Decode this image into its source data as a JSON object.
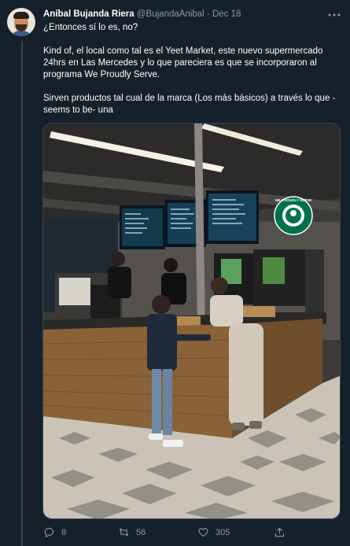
{
  "tweet": {
    "author_name": "Aníbal Bujanda Riera",
    "handle": "@BujandaAnibal",
    "separator": "·",
    "date": "Dec 18",
    "paragraphs": [
      "¿Entonces sí lo es, no?",
      "Kind of, el local como tal es el Yeet Market, este nuevo supermercado 24hrs en Las Mercedes y lo que pareciera es que se incorporaron al programa We Proudly Serve.",
      "Sirven productos tal cual de la marca (Los más básicos) a través lo que -seems to be- una"
    ]
  },
  "media": {
    "logo_text": "WE PROUDLY SERVE"
  },
  "actions": {
    "replies": "8",
    "retweets": "56",
    "likes": "305"
  },
  "icons": {
    "more": "more-icon",
    "reply": "reply-icon",
    "retweet": "retweet-icon",
    "like": "heart-icon",
    "share": "share-icon"
  },
  "colors": {
    "background": "#15202b",
    "secondary_text": "#8899a6",
    "primary_text": "#ffffff",
    "starbucks_green": "#00704a"
  }
}
